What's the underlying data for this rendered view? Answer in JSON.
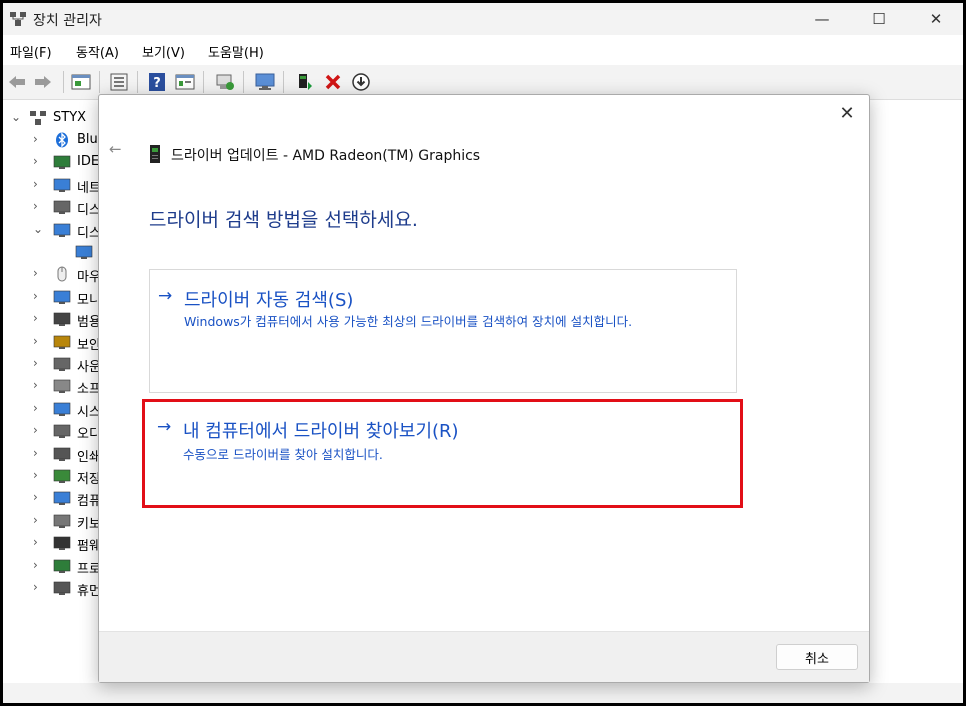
{
  "window": {
    "title": "장치 관리자",
    "controls": {
      "minimize": "—",
      "maximize": "☐",
      "close": "✕"
    }
  },
  "menu": [
    "파일(F)",
    "동작(A)",
    "보기(V)",
    "도움말(H)"
  ],
  "toolbar": {
    "icons": [
      "back-arrow-icon",
      "forward-arrow-icon",
      "properties-icon",
      "view-icon",
      "help-icon",
      "view-resources-icon",
      "scan-hardware-icon",
      "monitor-icon",
      "update-driver-icon",
      "uninstall-icon",
      "download-icon"
    ]
  },
  "tree": {
    "root": "STYX",
    "items": [
      {
        "label": "Blu",
        "icon": "bluetooth-icon"
      },
      {
        "label": "IDE",
        "icon": "ide-controller-icon"
      },
      {
        "label": "네트",
        "icon": "network-icon"
      },
      {
        "label": "디스",
        "icon": "disk-drive-icon"
      },
      {
        "label": "디스",
        "icon": "display-adapter-icon",
        "expanded": true
      },
      {
        "label": "",
        "icon": "gpu-icon",
        "child": true
      },
      {
        "label": "마우",
        "icon": "mouse-icon"
      },
      {
        "label": "모니",
        "icon": "monitor-icon"
      },
      {
        "label": "범용",
        "icon": "usb-icon"
      },
      {
        "label": "보안",
        "icon": "security-device-icon"
      },
      {
        "label": "사운",
        "icon": "audio-icon"
      },
      {
        "label": "소프",
        "icon": "software-device-icon"
      },
      {
        "label": "시스",
        "icon": "system-device-icon"
      },
      {
        "label": "오디",
        "icon": "speaker-icon"
      },
      {
        "label": "인쇄",
        "icon": "printer-icon"
      },
      {
        "label": "저장",
        "icon": "storage-controller-icon"
      },
      {
        "label": "컴퓨",
        "icon": "computer-icon"
      },
      {
        "label": "키보",
        "icon": "keyboard-icon"
      },
      {
        "label": "펌웨",
        "icon": "firmware-icon"
      },
      {
        "label": "프로",
        "icon": "processor-icon"
      },
      {
        "label": "휴먼",
        "icon": "hid-icon"
      }
    ]
  },
  "dialog": {
    "title": "드라이버 업데이트 - AMD Radeon(TM) Graphics",
    "heading": "드라이버 검색 방법을 선택하세요.",
    "options": [
      {
        "arrow": "→",
        "title": "드라이버 자동 검색(S)",
        "description": "Windows가 컴퓨터에서 사용 가능한 최상의 드라이버를 검색하여 장치에 설치합니다."
      },
      {
        "arrow": "→",
        "title": "내 컴퓨터에서 드라이버 찾아보기(R)",
        "description": "수동으로 드라이버를 찾아 설치합니다."
      }
    ],
    "cancel_label": "취소",
    "close_glyph": "✕",
    "back_glyph": "←",
    "highlight_color": "#e20e17",
    "link_color": "#1a52c4"
  }
}
